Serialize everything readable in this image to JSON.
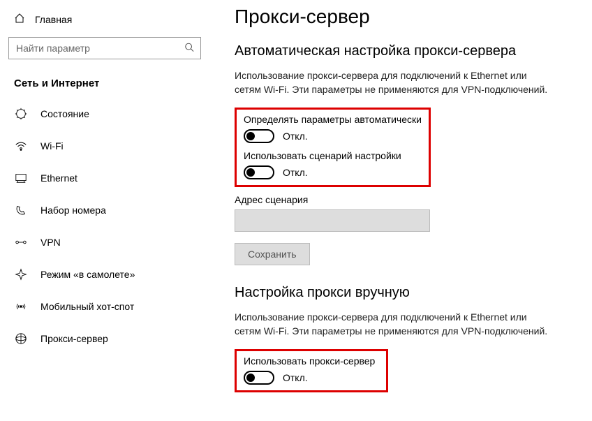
{
  "sidebar": {
    "home_label": "Главная",
    "search_placeholder": "Найти параметр",
    "category": "Сеть и Интернет",
    "items": [
      {
        "label": "Состояние",
        "icon": "status"
      },
      {
        "label": "Wi-Fi",
        "icon": "wifi"
      },
      {
        "label": "Ethernet",
        "icon": "ethernet"
      },
      {
        "label": "Набор номера",
        "icon": "dialup"
      },
      {
        "label": "VPN",
        "icon": "vpn"
      },
      {
        "label": "Режим «в самолете»",
        "icon": "airplane"
      },
      {
        "label": "Мобильный хот-спот",
        "icon": "hotspot"
      },
      {
        "label": "Прокси-сервер",
        "icon": "proxy"
      }
    ]
  },
  "main": {
    "title": "Прокси-сервер",
    "auto": {
      "title": "Автоматическая настройка прокси-сервера",
      "desc": "Использование прокси-сервера для подключений к Ethernet или сетям Wi-Fi. Эти параметры не применяются для VPN-подключений.",
      "detect_label": "Определять параметры автоматически",
      "detect_state": "Откл.",
      "script_label": "Использовать сценарий настройки",
      "script_state": "Откл.",
      "address_label": "Адрес сценария",
      "address_value": "",
      "save": "Сохранить"
    },
    "manual": {
      "title": "Настройка прокси вручную",
      "desc": "Использование прокси-сервера для подключений к Ethernet или сетям Wi-Fi. Эти параметры не применяются для VPN-подключений.",
      "use_label": "Использовать прокси-сервер",
      "use_state": "Откл."
    }
  }
}
